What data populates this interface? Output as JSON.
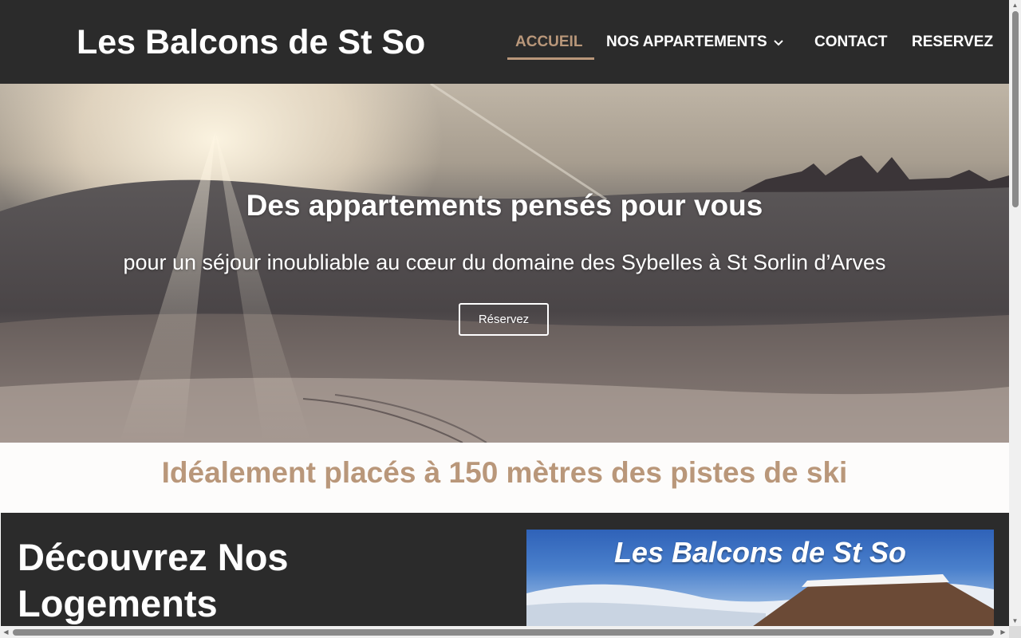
{
  "header": {
    "site_title": "Les Balcons de St So",
    "nav": [
      {
        "label": "ACCUEIL",
        "active": true
      },
      {
        "label": "NOS APPARTEMENTS",
        "has_dropdown": true
      },
      {
        "label": "CONTACT"
      },
      {
        "label": "RESERVEZ"
      }
    ]
  },
  "hero": {
    "title": "Des appartements pensés pour vous",
    "subtitle": "pour un séjour inoubliable au cœur du domaine des Sybelles à St Sorlin d’Arves",
    "button_label": "Réservez"
  },
  "tagline": {
    "text": "Idéalement placés à 150 mètres des pistes de ski"
  },
  "lower": {
    "title": "Découvrez Nos Logements",
    "image_title": "Les Balcons de St So"
  },
  "colors": {
    "header_bg": "#2b2b2b",
    "accent": "#b9977a",
    "text_light": "#ffffff"
  }
}
